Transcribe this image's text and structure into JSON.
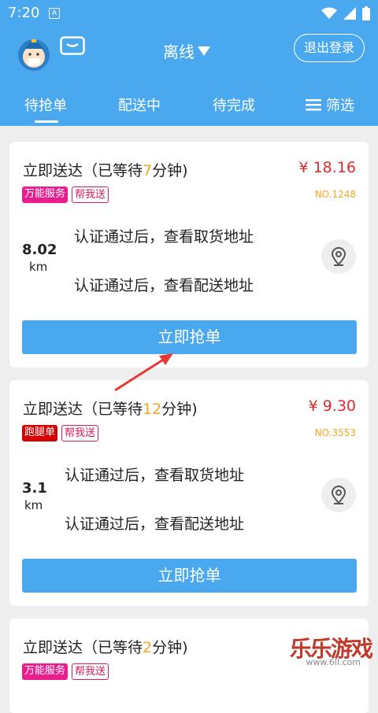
{
  "statusbar": {
    "time": "7:20",
    "a_icon": "A"
  },
  "header": {
    "status_label": "离线",
    "logout_label": "退出登录"
  },
  "tabs": [
    {
      "label": "待抢单",
      "active": true
    },
    {
      "label": "配送中",
      "active": false
    },
    {
      "label": "待完成",
      "active": false
    },
    {
      "label": "筛选",
      "active": false
    }
  ],
  "orders": [
    {
      "title_prefix": "立即送达（已等待",
      "wait": "7",
      "title_suffix": "分钟)",
      "price": "¥ 18.16",
      "order_no": "NO.1248",
      "tags": [
        {
          "label": "万能服务",
          "color": "#e91e8c"
        },
        {
          "label": "帮我送"
        }
      ],
      "distance": "8.02",
      "distance_unit": "km",
      "pickup": "认证通过后，查看取货地址",
      "delivery": "认证通过后，查看配送地址",
      "grab_label": "立即抢单"
    },
    {
      "title_prefix": "立即送达（已等待",
      "wait": "12",
      "title_suffix": "分钟)",
      "price": "¥ 9.30",
      "order_no": "NO.3553",
      "tags": [
        {
          "label": "跑腿单",
          "color": "#d50000"
        },
        {
          "label": "帮我送"
        }
      ],
      "distance": "3.1",
      "distance_unit": "km",
      "pickup": "认证通过后，查看取货地址",
      "delivery": "认证通过后，查看配送地址",
      "grab_label": "立即抢单"
    },
    {
      "title_prefix": "立即送达（已等待",
      "wait": "2",
      "title_suffix": "分钟)",
      "tags": [
        {
          "label": "万能服务",
          "color": "#e91e8c"
        },
        {
          "label": "帮我送"
        }
      ]
    }
  ],
  "watermark": {
    "text": "乐乐游戏",
    "url": "www.6ll.com"
  },
  "colors": {
    "primary": "#4aa8ee",
    "price": "#e02a2a",
    "accent": "#f5a623"
  }
}
